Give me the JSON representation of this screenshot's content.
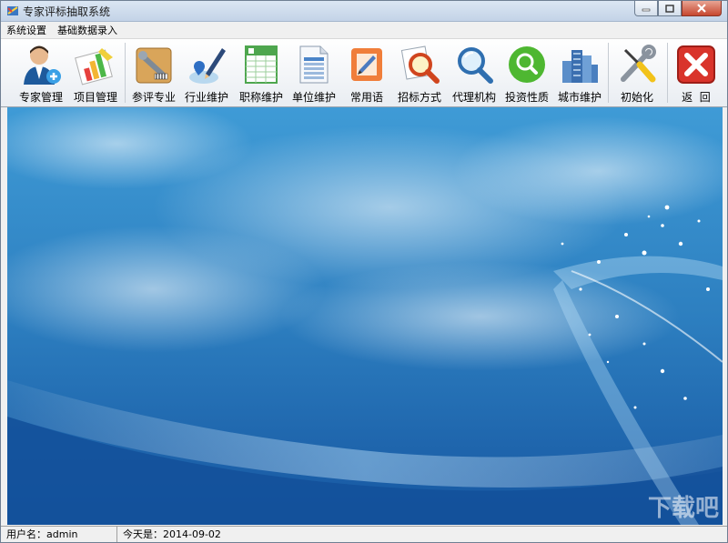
{
  "window": {
    "title": "专家评标抽取系统"
  },
  "menu": [
    {
      "label": "系统设置"
    },
    {
      "label": "基础数据录入"
    }
  ],
  "toolbar": [
    {
      "label": "专家管理",
      "icon": "user-add-icon"
    },
    {
      "label": "项目管理",
      "icon": "bar-chart-icon"
    },
    {
      "label": "参评专业",
      "icon": "toolbox-icon"
    },
    {
      "label": "行业维护",
      "icon": "map-pencil-icon"
    },
    {
      "label": "职称维护",
      "icon": "spreadsheet-icon"
    },
    {
      "label": "单位维护",
      "icon": "document-table-icon"
    },
    {
      "label": "常用语",
      "icon": "note-edit-icon"
    },
    {
      "label": "招标方式",
      "icon": "magnifier-document-icon"
    },
    {
      "label": "代理机构",
      "icon": "magnifier-icon"
    },
    {
      "label": "投资性质",
      "icon": "green-search-icon"
    },
    {
      "label": "城市维护",
      "icon": "city-buildings-icon"
    },
    {
      "label": "初始化",
      "icon": "wrench-screwdriver-icon"
    },
    {
      "label": "返  回",
      "icon": "red-close-icon"
    }
  ],
  "status": {
    "user": "用户名：admin",
    "date": "今天是：2014-09-02"
  },
  "watermark": "下载吧"
}
